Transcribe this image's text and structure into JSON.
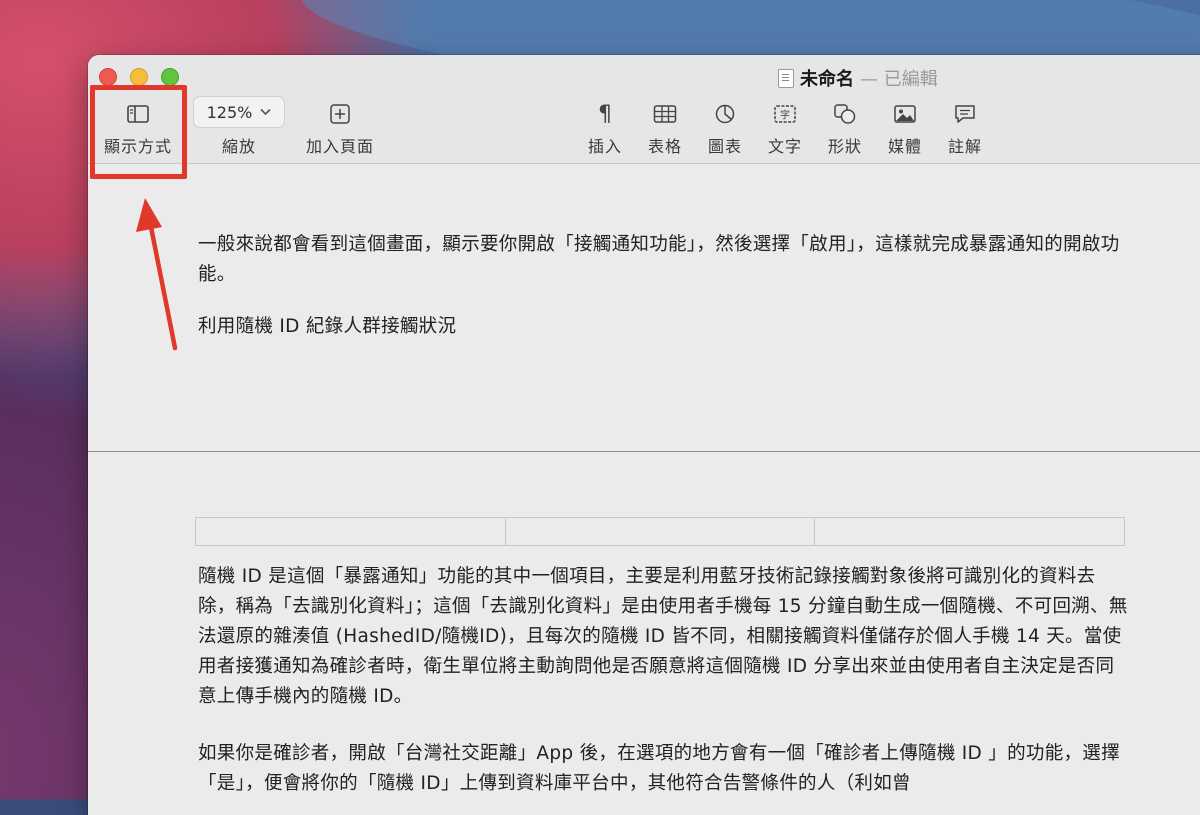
{
  "window": {
    "doc_title": "未命名",
    "doc_status": "— 已編輯"
  },
  "toolbar": {
    "view": "顯示方式",
    "zoom_value": "125%",
    "zoom": "縮放",
    "add_page": "加入頁面",
    "insert": "插入",
    "table": "表格",
    "chart": "圖表",
    "text": "文字",
    "shape": "形狀",
    "media": "媒體",
    "comment": "註解"
  },
  "document": {
    "para1": "一般來說都會看到這個畫面，顯示要你開啟「接觸通知功能」，然後選擇「啟用」，這樣就完成暴露通知的開啟功能。",
    "heading1": "利用隨機 ID 紀錄人群接觸狀況",
    "para2": "隨機 ID 是這個「暴露通知」功能的其中一個項目，主要是利用藍牙技術記錄接觸對象後將可識別化的資料去除，稱為「去識別化資料」；這個「去識別化資料」是由使用者手機每 15 分鐘自動生成一個隨機、不可回溯、無法還原的雜湊值 (HashedID/隨機ID)，且每次的隨機 ID 皆不同，相關接觸資料僅儲存於個人手機 14 天。當使用者接獲通知為確診者時，衛生單位將主動詢問他是否願意將這個隨機 ID 分享出來並由使用者自主決定是否同意上傳手機內的隨機 ID。",
    "para3": "如果你是確診者，開啟「台灣社交距離」App 後，在選項的地方會有一個「確診者上傳隨機 ID 」的功能，選擇「是」，便會將你的「隨機 ID」上傳到資料庫平台中，其他符合告警條件的人（利如曾"
  },
  "colors": {
    "highlight": "#e0382a"
  }
}
